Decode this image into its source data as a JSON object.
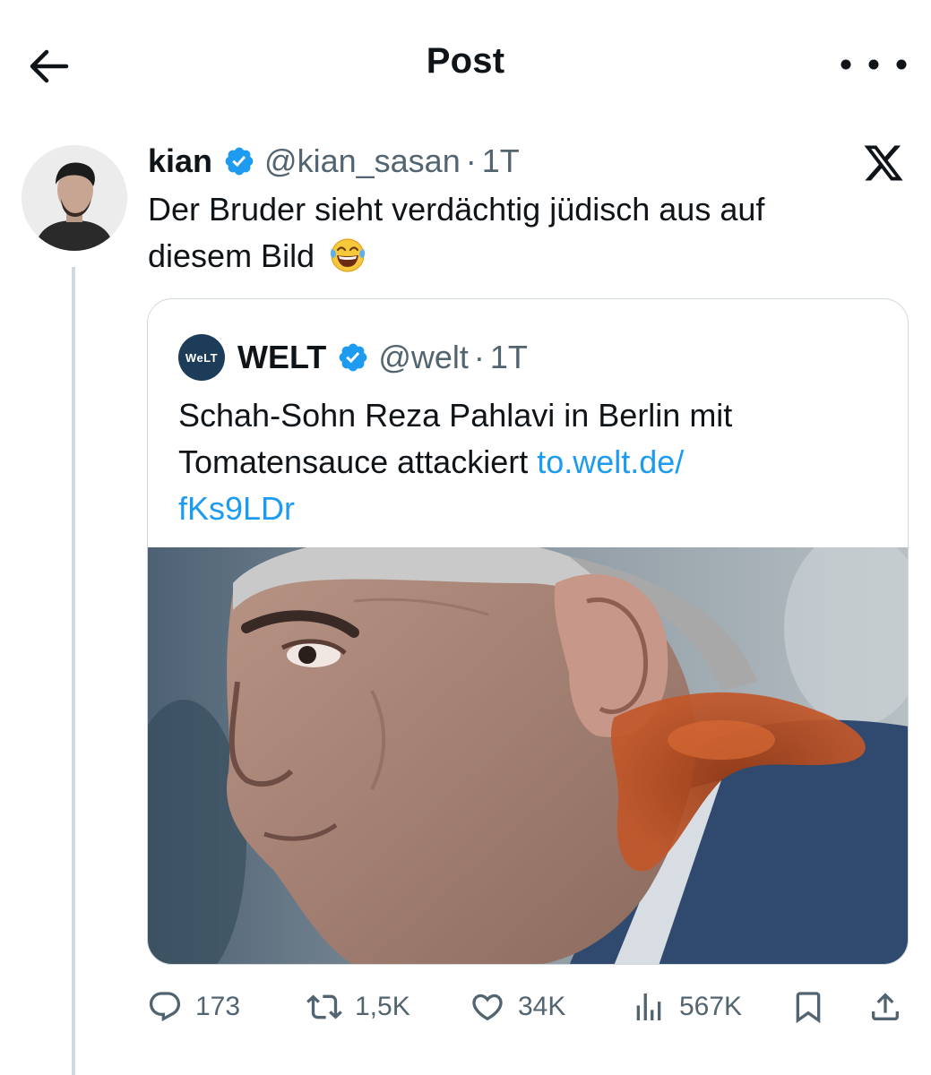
{
  "header": {
    "title": "Post",
    "back_icon": "arrow-left-icon",
    "more_icon": "more-horizontal-icon"
  },
  "post": {
    "author_name": "kian",
    "handle": "@kian_sasan",
    "separator": "·",
    "time": "1T",
    "text_line1": "Der Bruder sieht verdächtig jüdisch aus auf",
    "text_line2": "diesem Bild",
    "emoji": "😂"
  },
  "quote": {
    "logo_text": "WeLT",
    "author_name": "WELT",
    "handle": "@welt",
    "separator": "·",
    "time": "1T",
    "text_line1": "Schah-Sohn Reza Pahlavi in Berlin mit",
    "text_line2": "Tomatensauce attackiert ",
    "link_part1": "to.welt.de/",
    "link_part2": "fKs9LDr"
  },
  "actions": {
    "replies": "173",
    "reposts": "1,5K",
    "likes": "34K",
    "views": "567K"
  },
  "colors": {
    "accent": "#1d9bf0",
    "text": "#0f1419",
    "secondary": "#536471",
    "border": "#cfd9de"
  }
}
